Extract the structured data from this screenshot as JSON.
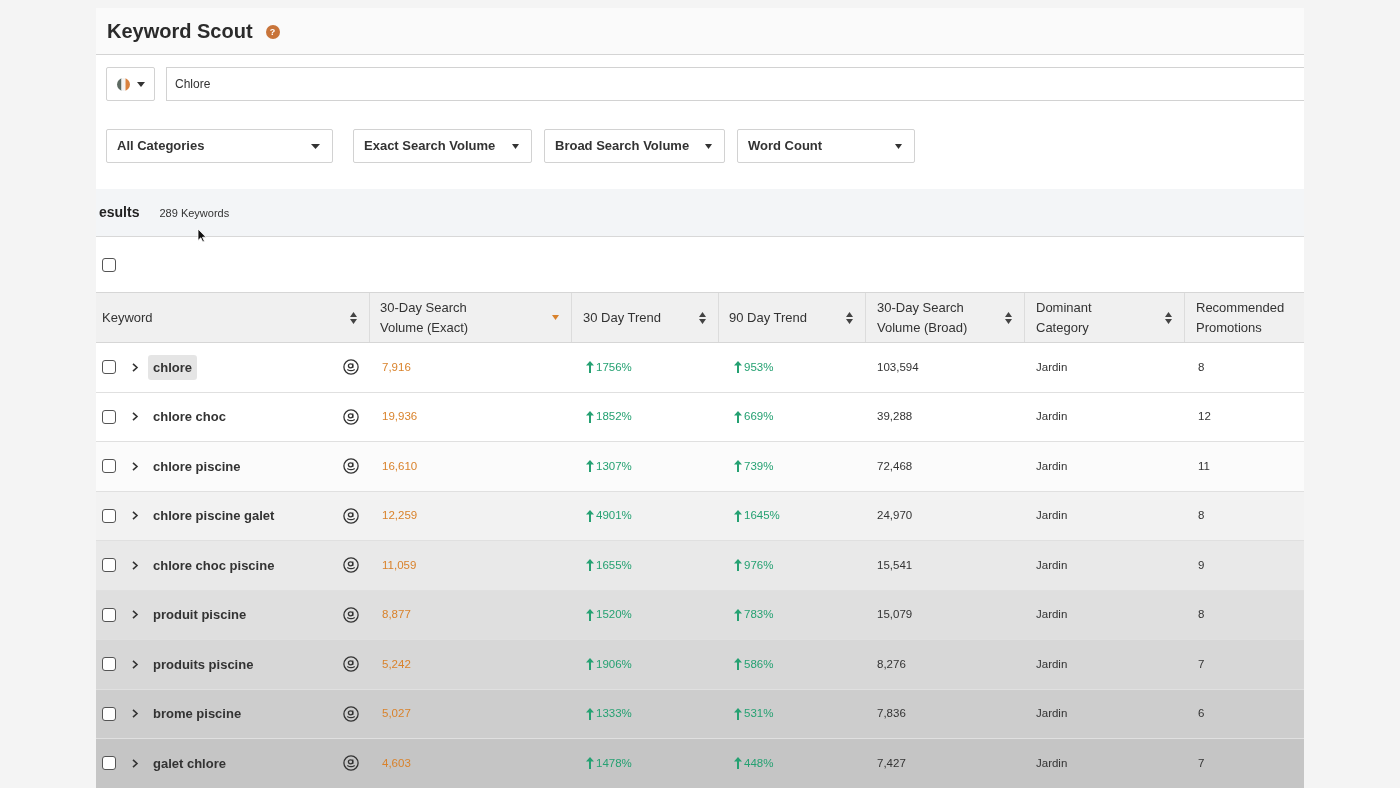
{
  "header": {
    "title": "Keyword Scout",
    "help": "?"
  },
  "search": {
    "value": "Chlore"
  },
  "filters": [
    {
      "label": "All Categories"
    },
    {
      "label": "Exact Search Volume"
    },
    {
      "label": "Broad Search Volume"
    },
    {
      "label": "Word Count"
    }
  ],
  "results": {
    "label": "esults",
    "count": "289 Keywords"
  },
  "select_all": {
    "checked": false
  },
  "table": {
    "columns": [
      {
        "label": "Keyword",
        "sorted": false
      },
      {
        "label": "30-Day Search Volume (Exact)",
        "sorted": true
      },
      {
        "label": "30 Day Trend",
        "sorted": false
      },
      {
        "label": "90 Day Trend",
        "sorted": false
      },
      {
        "label": "30-Day Search Volume (Broad)",
        "sorted": false
      },
      {
        "label": "Dominant Category",
        "sorted": false
      },
      {
        "label": "Recommended Promotions"
      }
    ],
    "rows": [
      {
        "checked": false,
        "expanded": false,
        "highlighted": true,
        "keyword": "chlore",
        "exact_volume": "7,916",
        "trend_30": {
          "value": "1756%",
          "rising": true
        },
        "trend_90": {
          "value": "953%",
          "rising": true
        },
        "broad_volume": "103,594",
        "category": "Jardin",
        "promotions": "8"
      },
      {
        "checked": false,
        "expanded": false,
        "highlighted": false,
        "keyword": "chlore choc",
        "exact_volume": "19,936",
        "trend_30": {
          "value": "1852%",
          "rising": true
        },
        "trend_90": {
          "value": "669%",
          "rising": true
        },
        "broad_volume": "39,288",
        "category": "Jardin",
        "promotions": "12"
      },
      {
        "checked": false,
        "expanded": false,
        "highlighted": false,
        "keyword": "chlore piscine",
        "exact_volume": "16,610",
        "trend_30": {
          "value": "1307%",
          "rising": true
        },
        "trend_90": {
          "value": "739%",
          "rising": true
        },
        "broad_volume": "72,468",
        "category": "Jardin",
        "promotions": "11"
      },
      {
        "checked": false,
        "expanded": false,
        "highlighted": false,
        "keyword": "chlore piscine galet",
        "exact_volume": "12,259",
        "trend_30": {
          "value": "4901%",
          "rising": true
        },
        "trend_90": {
          "value": "1645%",
          "rising": true
        },
        "broad_volume": "24,970",
        "category": "Jardin",
        "promotions": "8"
      },
      {
        "checked": false,
        "expanded": false,
        "highlighted": false,
        "keyword": "chlore choc piscine",
        "exact_volume": "11,059",
        "trend_30": {
          "value": "1655%",
          "rising": true
        },
        "trend_90": {
          "value": "976%",
          "rising": true
        },
        "broad_volume": "15,541",
        "category": "Jardin",
        "promotions": "9"
      },
      {
        "checked": false,
        "expanded": false,
        "highlighted": false,
        "keyword": "produit piscine",
        "exact_volume": "8,877",
        "trend_30": {
          "value": "1520%",
          "rising": true
        },
        "trend_90": {
          "value": "783%",
          "rising": true
        },
        "broad_volume": "15,079",
        "category": "Jardin",
        "promotions": "8"
      },
      {
        "checked": false,
        "expanded": false,
        "highlighted": false,
        "keyword": "produits piscine",
        "exact_volume": "5,242",
        "trend_30": {
          "value": "1906%",
          "rising": true
        },
        "trend_90": {
          "value": "586%",
          "rising": true
        },
        "broad_volume": "8,276",
        "category": "Jardin",
        "promotions": "7"
      },
      {
        "checked": false,
        "expanded": false,
        "highlighted": false,
        "keyword": "brome piscine",
        "exact_volume": "5,027",
        "trend_30": {
          "value": "1333%",
          "rising": true
        },
        "trend_90": {
          "value": "531%",
          "rising": true
        },
        "broad_volume": "7,836",
        "category": "Jardin",
        "promotions": "6"
      },
      {
        "checked": false,
        "expanded": false,
        "highlighted": false,
        "keyword": "galet chlore",
        "exact_volume": "4,603",
        "trend_30": {
          "value": "1478%",
          "rising": true
        },
        "trend_90": {
          "value": "448%",
          "rising": true
        },
        "broad_volume": "7,427",
        "category": "Jardin",
        "promotions": "7"
      }
    ]
  }
}
